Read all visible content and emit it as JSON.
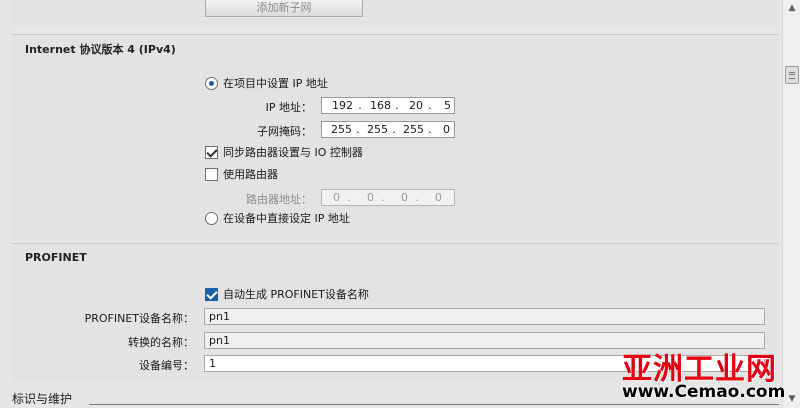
{
  "top": {
    "add_subnet_button": "添加新子网"
  },
  "ipv4": {
    "title": "Internet 协议版本 4 (IPv4)",
    "set_in_project_label": "在项目中设置 IP 地址",
    "ip_address_label": "IP 地址：",
    "ip_address": [
      "192",
      "168",
      "20",
      "5"
    ],
    "subnet_mask_label": "子网掩码：",
    "subnet_mask": [
      "255",
      "255",
      "255",
      "0"
    ],
    "sync_router_label": "同步路由器设置与 IO 控制器",
    "use_router_label": "使用路由器",
    "router_address_label": "路由器地址：",
    "router_address": [
      "0",
      "0",
      "0",
      "0"
    ],
    "set_on_device_label": "在设备中直接设定 IP 地址"
  },
  "profinet": {
    "title": "PROFINET",
    "auto_generate_label": "自动生成 PROFINET设备名称",
    "device_name_label": "PROFINET设备名称：",
    "device_name": "pn1",
    "converted_name_label": "转换的名称：",
    "converted_name": "pn1",
    "device_number_label": "设备编号：",
    "device_number": "1"
  },
  "next_section": {
    "title": "标识与维护"
  },
  "watermark": {
    "line1": "亚洲工业网",
    "line2": "www.Cemao.com"
  },
  "colors": {
    "accent": "#1d5fa8",
    "panel": "#e3e3e3",
    "watermark_red": "#e60012"
  }
}
